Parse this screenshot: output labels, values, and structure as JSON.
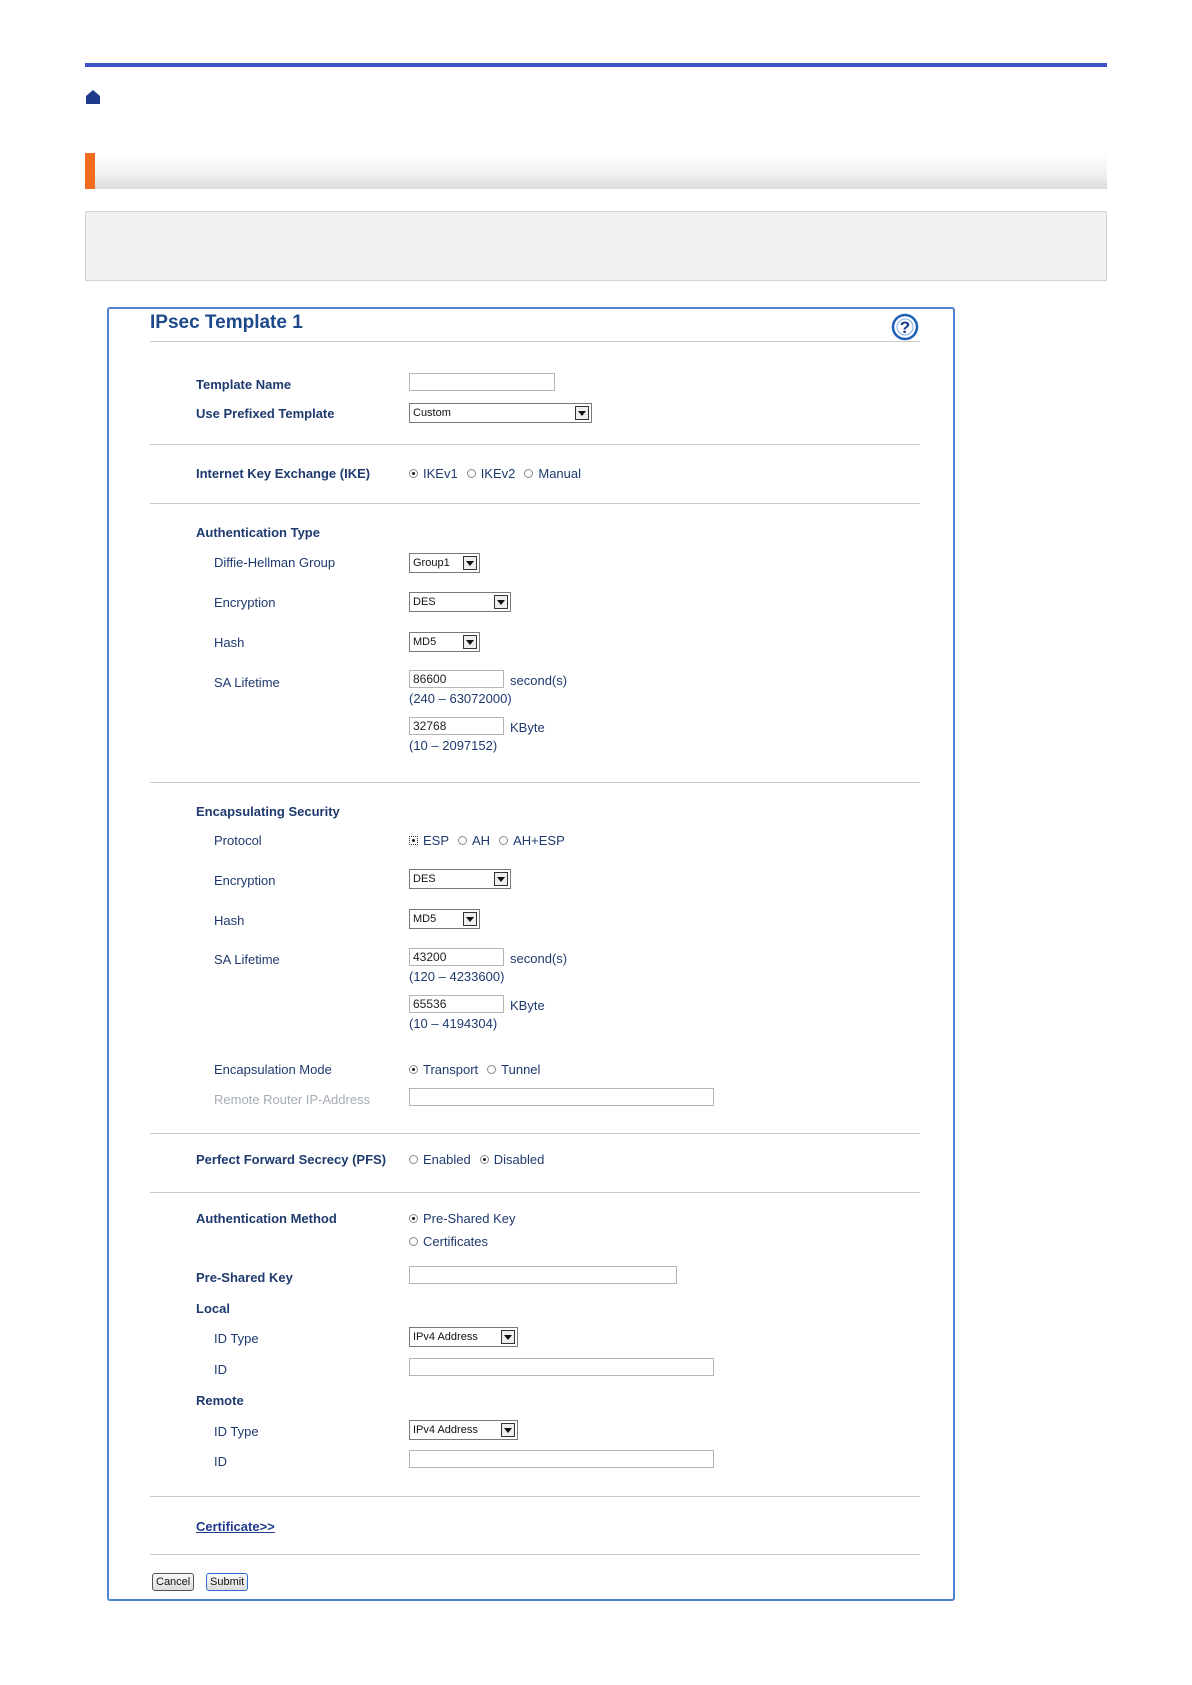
{
  "colors": {
    "accent_rule": "#3b55c9",
    "section_accent": "#f26b1f",
    "panel_border": "#4f83d6",
    "label_text": "#1e3a6e"
  },
  "icons": {
    "home": "home-icon",
    "help": "help-icon"
  },
  "panel": {
    "title": "IPsec Template 1"
  },
  "template": {
    "name_label": "Template Name",
    "name_value": "",
    "prefixed_label": "Use Prefixed Template",
    "prefixed_value": "Custom"
  },
  "ike": {
    "label": "Internet Key Exchange (IKE)",
    "options": [
      "IKEv1",
      "IKEv2",
      "Manual"
    ],
    "selected": "IKEv1"
  },
  "auth_type": {
    "heading": "Authentication Type",
    "dh_label": "Diffie-Hellman Group",
    "dh_value": "Group1",
    "enc_label": "Encryption",
    "enc_value": "DES",
    "hash_label": "Hash",
    "hash_value": "MD5",
    "sa_label": "SA Lifetime",
    "sa_seconds": "86600",
    "sa_seconds_unit": "second(s)",
    "sa_seconds_range": "(240 – 63072000)",
    "sa_kbyte": "32768",
    "sa_kbyte_unit": "KByte",
    "sa_kbyte_range": "(10 – 2097152)"
  },
  "encap": {
    "heading": "Encapsulating Security",
    "protocol_label": "Protocol",
    "protocol_options": [
      "ESP",
      "AH",
      "AH+ESP"
    ],
    "protocol_selected": "ESP",
    "enc_label": "Encryption",
    "enc_value": "DES",
    "hash_label": "Hash",
    "hash_value": "MD5",
    "sa_label": "SA Lifetime",
    "sa_seconds": "43200",
    "sa_seconds_unit": "second(s)",
    "sa_seconds_range": "(120 – 4233600)",
    "sa_kbyte": "65536",
    "sa_kbyte_unit": "KByte",
    "sa_kbyte_range": "(10 – 4194304)",
    "mode_label": "Encapsulation Mode",
    "mode_options": [
      "Transport",
      "Tunnel"
    ],
    "mode_selected": "Transport",
    "remote_router_label": "Remote Router IP-Address",
    "remote_router_value": ""
  },
  "pfs": {
    "label": "Perfect Forward Secrecy (PFS)",
    "options": [
      "Enabled",
      "Disabled"
    ],
    "selected": "Disabled"
  },
  "auth_method": {
    "label": "Authentication Method",
    "options": [
      "Pre-Shared Key",
      "Certificates"
    ],
    "selected": "Pre-Shared Key",
    "psk_label": "Pre-Shared Key",
    "psk_value": ""
  },
  "local": {
    "heading": "Local",
    "id_type_label": "ID Type",
    "id_type_value": "IPv4 Address",
    "id_label": "ID",
    "id_value": ""
  },
  "remote": {
    "heading": "Remote",
    "id_type_label": "ID Type",
    "id_type_value": "IPv4 Address",
    "id_label": "ID",
    "id_value": ""
  },
  "certificate_link": "Certificate>>",
  "buttons": {
    "cancel": "Cancel",
    "submit": "Submit"
  }
}
